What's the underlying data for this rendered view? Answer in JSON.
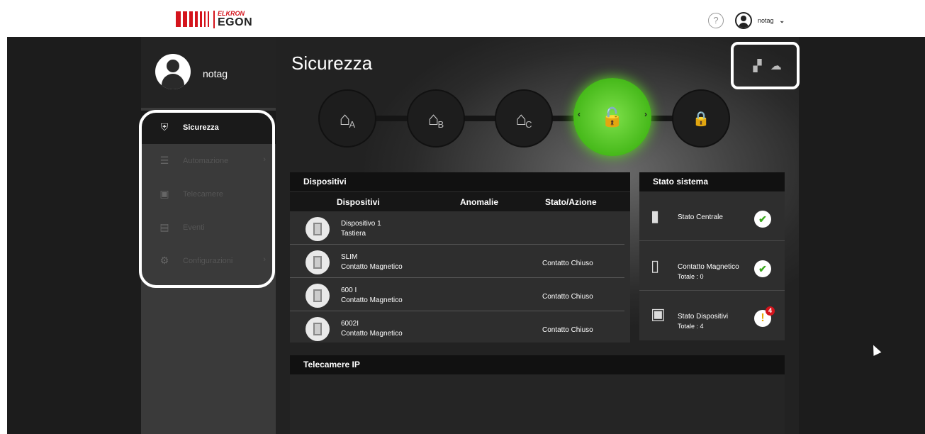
{
  "header": {
    "logo_top": "ELKRON",
    "logo_bottom": "EGON",
    "help": "?",
    "username": "notag",
    "chevron": "⌄"
  },
  "sidebar": {
    "username": "notag",
    "items": [
      {
        "label": "Sicurezza",
        "icon": "shield-icon",
        "active": true
      },
      {
        "label": "Automazione",
        "icon": "sliders-icon",
        "arrow": "›"
      },
      {
        "label": "Telecamere",
        "icon": "camera-icon"
      },
      {
        "label": "Eventi",
        "icon": "list-icon"
      },
      {
        "label": "Configurazioni",
        "icon": "gear-icon",
        "arrow": "›"
      }
    ]
  },
  "page": {
    "title": "Sicurezza"
  },
  "modes": [
    {
      "label": "A",
      "icon": "home-icon"
    },
    {
      "label": "B",
      "icon": "home-icon"
    },
    {
      "label": "C",
      "icon": "home-icon"
    },
    {
      "label": "",
      "icon": "unlock-icon",
      "active": true
    },
    {
      "label": "",
      "icon": "lock-icon"
    }
  ],
  "devices": {
    "title": "Dispositivi",
    "columns": [
      "Dispositivi",
      "Anomalie",
      "Stato/Azione"
    ],
    "rows": [
      {
        "name": "Dispositivo 1",
        "type": "Tastiera",
        "status": ""
      },
      {
        "name": "SLIM",
        "type": "Contatto Magnetico",
        "status": "Contatto Chiuso"
      },
      {
        "name": "600 I",
        "type": "Contatto Magnetico",
        "status": "Contatto Chiuso"
      },
      {
        "name": "6002I",
        "type": "Contatto Magnetico",
        "status": "Contatto Chiuso"
      }
    ]
  },
  "system": {
    "title": "Stato sistema",
    "rows": [
      {
        "label": "Stato Centrale",
        "total": ""
      },
      {
        "label": "Contatto Magnetico",
        "total": "Totale :  0"
      },
      {
        "label": "Stato Dispositivi",
        "total": "Totale :  4",
        "badge": "4"
      }
    ]
  },
  "cameras": {
    "title": "Telecamere IP"
  },
  "colors": {
    "accent_green": "#46b91a",
    "brand_red": "#d4141c"
  }
}
